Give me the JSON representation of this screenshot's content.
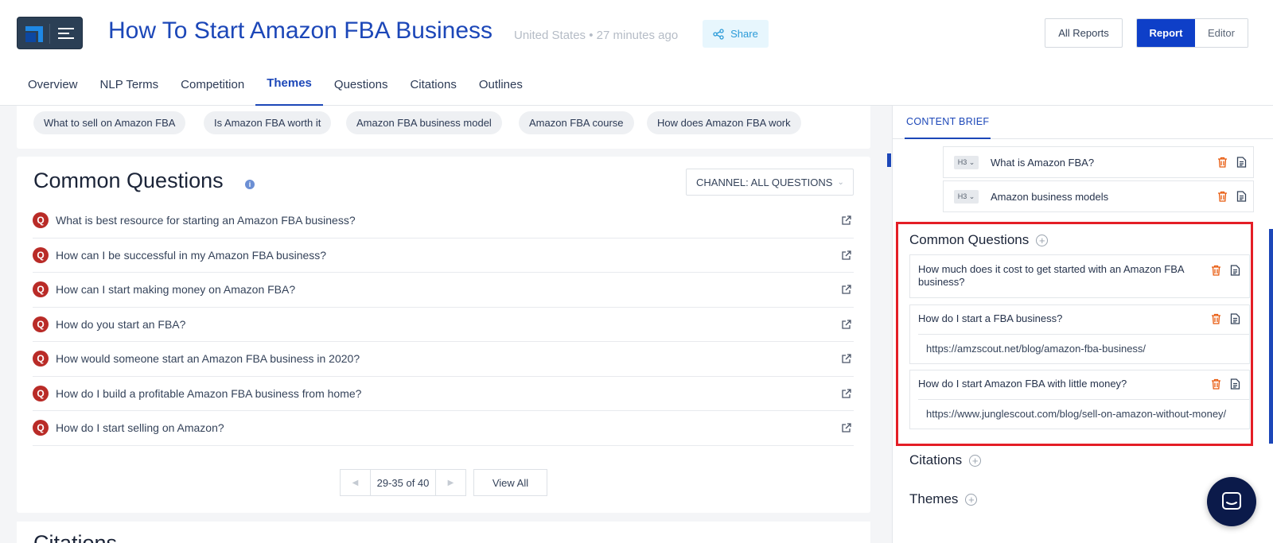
{
  "header": {
    "title": "How To Start Amazon FBA Business",
    "meta": "United States • 27 minutes ago",
    "share_label": "Share",
    "all_reports_label": "All Reports",
    "report_label": "Report",
    "editor_label": "Editor"
  },
  "tabs": [
    "Overview",
    "NLP Terms",
    "Competition",
    "Themes",
    "Questions",
    "Citations",
    "Outlines"
  ],
  "active_tab": "Themes",
  "theme_chips": [
    "What to sell on Amazon FBA",
    "Is Amazon FBA worth it",
    "Amazon FBA business model",
    "Amazon FBA course",
    "How does Amazon FBA work"
  ],
  "common_questions": {
    "title": "Common Questions",
    "info_glyph": "i",
    "channel_label": "CHANNEL: ALL QUESTIONS",
    "badge_glyph": "Q",
    "items": [
      "What is best resource for starting an Amazon FBA business?",
      "How can I be successful in my Amazon FBA business?",
      "How can I start making money on Amazon FBA?",
      "How do you start an FBA?",
      "How would someone start an Amazon FBA business in 2020?",
      "How do I build a profitable Amazon FBA business from home?",
      "How do I start selling on Amazon?"
    ],
    "pagination": "29-35 of 40",
    "view_all_label": "View All"
  },
  "citations_title": "Citations",
  "content_brief": {
    "tab_label": "CONTENT BRIEF",
    "headings": [
      {
        "tag": "H3",
        "text": "What is Amazon FBA?"
      },
      {
        "tag": "H3",
        "text": "Amazon business models"
      }
    ],
    "common_questions_title": "Common Questions",
    "questions": [
      {
        "q": "How much does it cost to get started with an Amazon FBA business?",
        "url": ""
      },
      {
        "q": "How do I start a FBA business?",
        "url": "https://amzscout.net/blog/amazon-fba-business/"
      },
      {
        "q": "How do I start Amazon FBA with little money?",
        "url": "https://www.junglescout.com/blog/sell-on-amazon-without-money/"
      }
    ],
    "citations_title": "Citations",
    "themes_title": "Themes"
  },
  "colors": {
    "primary": "#1c47b8",
    "highlight": "#e41e26",
    "quora": "#b92b27",
    "delete": "#e8590c"
  }
}
